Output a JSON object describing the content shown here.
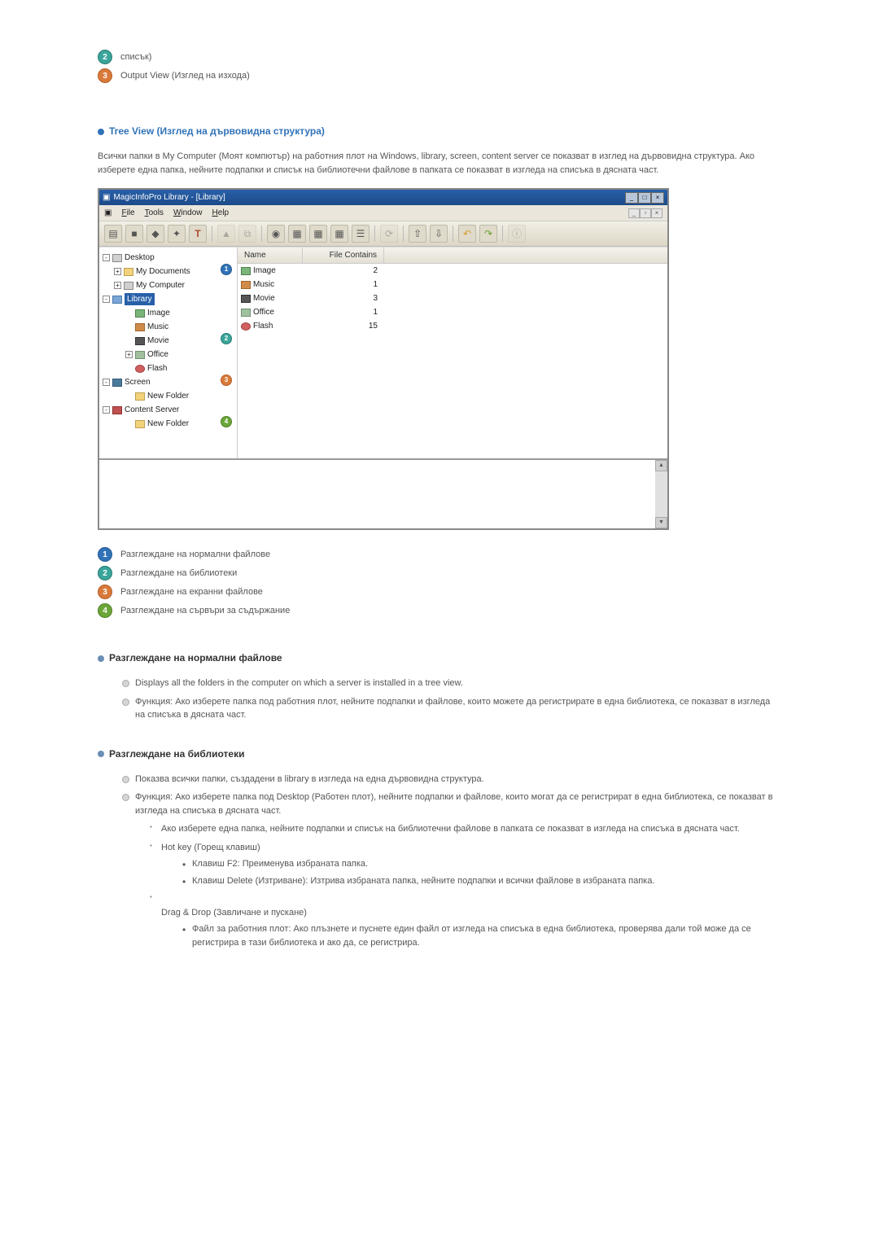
{
  "topCallouts": [
    {
      "n": "2",
      "color": "c-teal",
      "text": "списък)"
    },
    {
      "n": "3",
      "color": "c-orange",
      "text": "Output View (Изглед на изхода)"
    }
  ],
  "section1": {
    "title": "Tree View (Изглед на дървовидна структура)",
    "body": "Всички папки в My Computer (Моят компютър) на работния плот на Windows, library, screen, content server се показват в изглед на дървовидна структура. Ако изберете една папка, нейните подпапки и списък на библиотечни файлове в папката се показват в изгледа на списъка в дясната част."
  },
  "screenshot": {
    "title": "MagicInfoPro Library - [Library]",
    "menus": {
      "file": "File",
      "tools": "Tools",
      "window": "Window",
      "help": "Help"
    },
    "tree": {
      "desktop": "Desktop",
      "mydocs": "My Documents",
      "mycomp": "My Computer",
      "library": "Library",
      "image": "Image",
      "music": "Music",
      "movie": "Movie",
      "office": "Office",
      "flash": "Flash",
      "screen": "Screen",
      "newfolder1": "New Folder",
      "contentserver": "Content Server",
      "newfolder2": "New Folder"
    },
    "list": {
      "colName": "Name",
      "colContains": "File Contains",
      "rows": [
        {
          "name": "Image",
          "contains": "2",
          "icon": "tico-img"
        },
        {
          "name": "Music",
          "contains": "1",
          "icon": "tico-music"
        },
        {
          "name": "Movie",
          "contains": "3",
          "icon": "tico-movie"
        },
        {
          "name": "Office",
          "contains": "1",
          "icon": "tico-office"
        },
        {
          "name": "Flash",
          "contains": "15",
          "icon": "tico-flash"
        }
      ]
    }
  },
  "legendCallouts": [
    {
      "n": "1",
      "color": "c-blue",
      "text": "Разглеждане на нормални файлове"
    },
    {
      "n": "2",
      "color": "c-teal",
      "text": "Разглеждане на библиотеки"
    },
    {
      "n": "3",
      "color": "c-orange",
      "text": "Разглеждане на екранни файлове"
    },
    {
      "n": "4",
      "color": "c-green",
      "text": "Разглеждане на сървъри за съдържание"
    }
  ],
  "sectionNormal": {
    "title": "Разглеждане на нормални файлове",
    "item1": "Displays all the folders in the computer on which a server is installed in a tree view.",
    "item2": "Функция: Ако изберете папка под работния плот, нейните подпапки и файлове, които можете да регистрирате в една библиотека, се показват в изгледа на списъка в дясната част."
  },
  "sectionLibrary": {
    "title": "Разглеждане на библиотеки",
    "item1": "Показва всички папки, създадени в library в изгледа на една дървовидна структура.",
    "item2": "Функция: Ако изберете папка под Desktop (Работен плот), нейните подпапки и файлове, които могат да се регистрират в една библиотека, се показват в изгледа на списъка в дясната част.",
    "sub1": "Ако изберете една папка, нейните подпапки и списък на библиотечни файлове в папката се показват в изгледа на списъка в дясната част.",
    "sub2": "Hot key (Горещ клавиш)",
    "hk1": "Клавиш F2: Преименува избраната папка.",
    "hk2": "Клавиш Delete (Изтриване): Изтрива избраната папка, нейните подпапки и всички файлове в избраната папка.",
    "sub3": "Drag & Drop (Завличане и пускане)",
    "dd1": "Файл за работния плот: Ако плъзнете и пуснете един файл от изгледа на списъка в една библиотека, проверява дали той може да се регистрира в тази библиотека и ако да, се регистрира."
  }
}
